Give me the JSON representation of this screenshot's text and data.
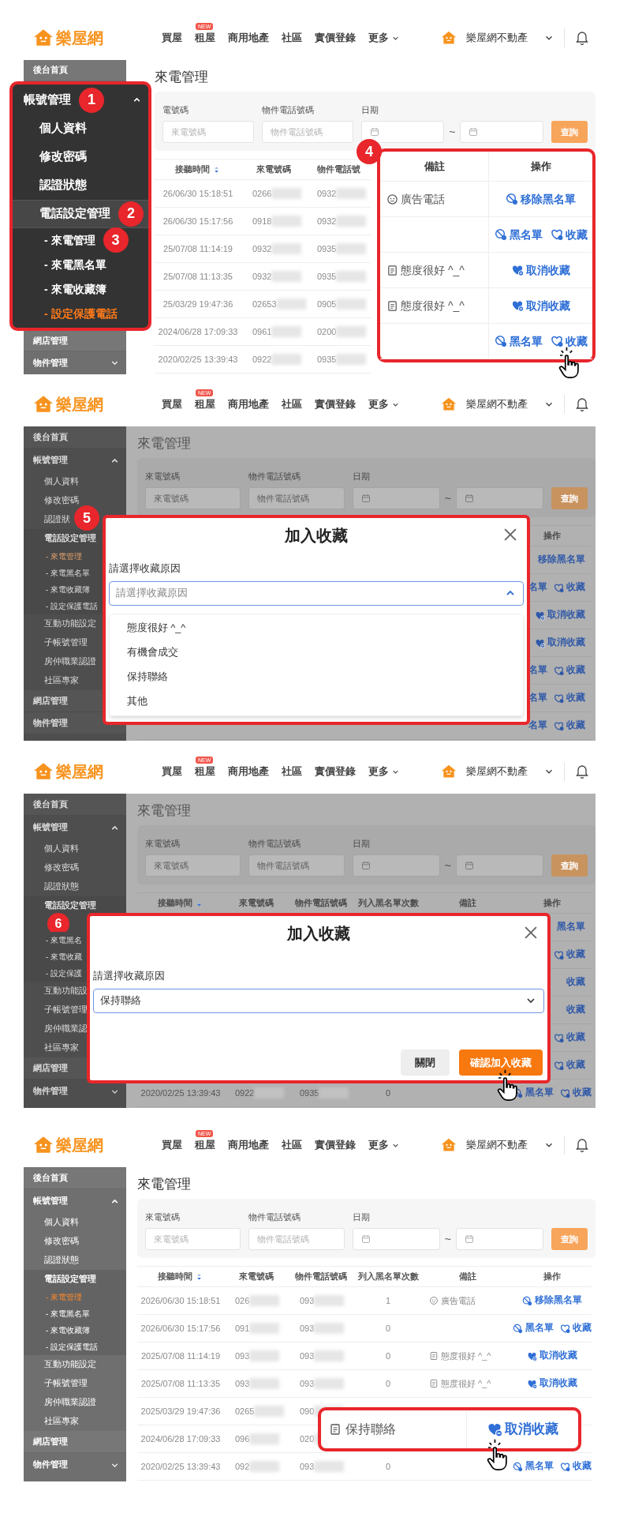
{
  "panels": [
    {
      "dimmed": false,
      "header": {
        "logo": "樂屋網",
        "nav": [
          {
            "label": "買屋",
            "menu": false
          },
          {
            "label": "租屋",
            "badge": "NEW",
            "menu": false
          },
          {
            "label": "商用地產",
            "menu": false
          },
          {
            "label": "社區",
            "menu": false
          },
          {
            "label": "實價登錄",
            "menu": false
          },
          {
            "label": "更多",
            "menu": true
          }
        ],
        "account": "樂屋網不動產"
      },
      "sidebar": [
        {
          "kind": "top",
          "label": "後台首頁"
        },
        {
          "kind": "zoom",
          "items": [
            {
              "kind": "group",
              "label": "帳號管理",
              "expanded": true,
              "step": "1"
            },
            {
              "kind": "item",
              "label": "個人資料"
            },
            {
              "kind": "item",
              "label": "修改密碼"
            },
            {
              "kind": "item",
              "label": "認證狀態"
            },
            {
              "kind": "section",
              "label": "電話設定管理",
              "step": "2"
            },
            {
              "kind": "sub",
              "label": "- 來電管理",
              "selected": false,
              "step": "3"
            },
            {
              "kind": "sub",
              "label": "- 來電黑名單",
              "selected": false
            },
            {
              "kind": "sub",
              "label": "- 來電收藏簿",
              "selected": false
            },
            {
              "kind": "sub",
              "label": "- 設定保護電話",
              "selected": true
            }
          ]
        },
        {
          "kind": "top",
          "label": "網店管理"
        },
        {
          "kind": "group",
          "label": "物件管理",
          "expanded": false
        }
      ],
      "title": "來電管理",
      "filter": {
        "caller_label": "電號碼",
        "caller_placeholder": "來電號碼",
        "property_label": "物件電話號碼",
        "property_placeholder": "物件電話號碼",
        "date_label": "日期",
        "separator": "~",
        "button": "查詢"
      },
      "table": {
        "columns": [
          {
            "kind": "time",
            "label": "接聽時間",
            "sortable": true
          },
          {
            "kind": "caller",
            "label": "來電號碼",
            "sortable": false
          },
          {
            "kind": "property",
            "label": "物件電話號",
            "sortable": false
          }
        ],
        "rows": [
          {
            "time": "26/06/30 15:18:51",
            "caller": "0266",
            "property": "0932"
          },
          {
            "time": "26/06/30 15:17:56",
            "caller": "0918",
            "property": "0932"
          },
          {
            "time": "25/07/08 11:14:19",
            "caller": "0932",
            "property": "0935"
          },
          {
            "time": "25/07/08 11:13:35",
            "caller": "0932",
            "property": "0935"
          },
          {
            "time": "25/03/29 19:47:36",
            "caller": "02653",
            "property": "0905"
          },
          {
            "time": "2024/06/28 17:09:33",
            "caller": "0961",
            "property": "0200"
          },
          {
            "time": "2020/02/25 13:39:43",
            "caller": "0922",
            "property": "0935"
          }
        ],
        "zoom": {
          "step": "4",
          "columns": [
            "備註",
            "操作"
          ],
          "rows": [
            {
              "note": {
                "kind": "face",
                "text": "廣告電話"
              },
              "actions": [
                {
                  "kind": "unblock",
                  "label": "移除黑名單"
                }
              ]
            },
            {
              "actions": [
                {
                  "kind": "block",
                  "label": "黑名單"
                },
                {
                  "kind": "fav",
                  "label": "收藏"
                }
              ]
            },
            {
              "note": {
                "kind": "note",
                "text": "態度很好 ^_^"
              },
              "actions": [
                {
                  "kind": "unfav",
                  "label": "取消收藏"
                }
              ]
            },
            {
              "note": {
                "kind": "note",
                "text": "態度很好 ^_^"
              },
              "actions": [
                {
                  "kind": "unfav",
                  "label": "取消收藏"
                }
              ]
            },
            {
              "actions": [
                {
                  "kind": "block",
                  "label": "黑名單"
                },
                {
                  "kind": "fav",
                  "label": "收藏",
                  "pointer": true
                }
              ]
            }
          ]
        }
      }
    },
    {
      "dimmed": true,
      "header": {
        "logo": "樂屋網",
        "nav": [
          {
            "label": "買屋",
            "menu": false
          },
          {
            "label": "租屋",
            "badge": "NEW",
            "menu": false
          },
          {
            "label": "商用地產",
            "menu": false
          },
          {
            "label": "社區",
            "menu": false
          },
          {
            "label": "實價登錄",
            "menu": false
          },
          {
            "label": "更多",
            "menu": true
          }
        ],
        "account": "樂屋網不動產"
      },
      "sidebar": [
        {
          "kind": "top",
          "label": "後台首頁"
        },
        {
          "kind": "group",
          "label": "帳號管理",
          "expanded": true
        },
        {
          "kind": "item",
          "label": "個人資料"
        },
        {
          "kind": "item",
          "label": "修改密碼"
        },
        {
          "kind": "item",
          "label": "認證狀"
        },
        {
          "kind": "section",
          "label": "電話設定管理"
        },
        {
          "kind": "sub",
          "label": "- 來電管理",
          "selected": true
        },
        {
          "kind": "sub",
          "label": "- 來電黑名單",
          "selected": false
        },
        {
          "kind": "sub",
          "label": "- 來電收藏簿",
          "selected": false
        },
        {
          "kind": "sub",
          "label": "- 設定保護電話",
          "selected": false
        },
        {
          "kind": "item",
          "label": "互動功能設定"
        },
        {
          "kind": "item",
          "label": "子帳號管理"
        },
        {
          "kind": "item",
          "label": "房仲職業認證"
        },
        {
          "kind": "item",
          "label": "社區專家"
        },
        {
          "kind": "top",
          "label": "網店管理"
        },
        {
          "kind": "top",
          "label": "物件管理"
        }
      ],
      "title": "來電管理",
      "filter": {
        "caller_label": "來電號碼",
        "caller_placeholder": "來電號碼",
        "property_label": "物件電話號碼",
        "property_placeholder": "物件電話號碼",
        "date_label": "日期",
        "separator": "~",
        "button": "查詢"
      },
      "table": {
        "columns": [
          {
            "kind": "actions",
            "label": "操作",
            "sortable": false
          }
        ],
        "rows": [
          {
            "clipped": true,
            "actions": [
              {
                "label": "移除黑名單"
              }
            ]
          },
          {
            "clipped": true,
            "actions": [
              {
                "label": "名單"
              },
              {
                "kind": "fav",
                "label": "收藏",
                "icon": true
              }
            ]
          },
          {
            "clipped": true,
            "actions": [
              {
                "kind": "unfav",
                "label": "取消收藏",
                "icon": true
              }
            ]
          },
          {
            "clipped": true,
            "actions": [
              {
                "kind": "unfav",
                "label": "取消收藏",
                "icon": true
              }
            ]
          },
          {
            "clipped": true,
            "actions": [
              {
                "label": "名單"
              },
              {
                "kind": "fav",
                "label": "收藏",
                "icon": true
              }
            ]
          },
          {
            "clipped": true,
            "actions": [
              {
                "label": "名單"
              },
              {
                "kind": "fav",
                "label": "收藏",
                "icon": true
              }
            ]
          },
          {
            "clipped": true,
            "actions": [
              {
                "label": "名單"
              },
              {
                "kind": "fav",
                "label": "收藏",
                "icon": true
              }
            ]
          }
        ]
      },
      "modal": {
        "step": "5",
        "title": "加入收藏",
        "label": "請選擇收藏原因",
        "select": {
          "placeholder": "請選擇收藏原因",
          "expanded": true
        },
        "options": [
          "態度很好 ^_^",
          "有機會成交",
          "保持聯絡",
          "其他"
        ]
      }
    },
    {
      "dimmed": true,
      "header": {
        "logo": "樂屋網",
        "nav": [
          {
            "label": "買屋",
            "menu": false
          },
          {
            "label": "租屋",
            "badge": "NEW",
            "menu": false
          },
          {
            "label": "商用地產",
            "menu": false
          },
          {
            "label": "社區",
            "menu": false
          },
          {
            "label": "實價登錄",
            "menu": false
          },
          {
            "label": "更多",
            "menu": true
          }
        ],
        "account": "樂屋網不動產"
      },
      "sidebar": [
        {
          "kind": "top",
          "label": "後台首頁"
        },
        {
          "kind": "group",
          "label": "帳號管理",
          "expanded": true
        },
        {
          "kind": "item",
          "label": "個人資料"
        },
        {
          "kind": "item",
          "label": "修改密碼"
        },
        {
          "kind": "item",
          "label": "認證狀態"
        },
        {
          "kind": "section",
          "label": "電話設定管理"
        },
        {
          "kind": "covered",
          "step": "6"
        },
        {
          "kind": "sub",
          "label": "- 來電黑名",
          "selected": false
        },
        {
          "kind": "sub",
          "label": "- 來電收藏",
          "selected": false
        },
        {
          "kind": "sub",
          "label": "- 設定保護",
          "selected": false
        },
        {
          "kind": "item",
          "label": "互動功能設"
        },
        {
          "kind": "item",
          "label": "子帳號管理"
        },
        {
          "kind": "item",
          "label": "房仲職業認"
        },
        {
          "kind": "item",
          "label": "社區專家"
        },
        {
          "kind": "top",
          "label": "網店管理"
        },
        {
          "kind": "group",
          "label": "物件管理",
          "expanded": false
        }
      ],
      "title": "來電管理",
      "filter": {
        "caller_label": "來電號碼",
        "caller_placeholder": "來電號碼",
        "property_label": "物件電話號碼",
        "property_placeholder": "物件電話號碼",
        "date_label": "日期",
        "separator": "~",
        "button": "查詢"
      },
      "table": {
        "columns": [
          {
            "kind": "time",
            "label": "接聽時間",
            "sortable": true
          },
          {
            "kind": "caller",
            "label": "來電號碼",
            "sortable": false
          },
          {
            "kind": "property",
            "label": "物件電話號碼",
            "sortable": false
          },
          {
            "kind": "count",
            "label": "列入黑名單次數",
            "sortable": false
          },
          {
            "kind": "note",
            "label": "備註",
            "sortable": false
          },
          {
            "kind": "actions",
            "label": "操作",
            "sortable": false
          }
        ],
        "rows": [
          {
            "clipped": true,
            "actions": [
              {
                "label": "黑名單"
              }
            ]
          },
          {
            "clipped": true,
            "actions": [
              {
                "kind": "fav",
                "label": "收藏",
                "icon": true
              }
            ]
          },
          {
            "clipped": true,
            "actions": [
              {
                "label": "收藏"
              }
            ]
          },
          {
            "clipped": true,
            "actions": [
              {
                "label": "收藏"
              }
            ]
          },
          {
            "clipped": true,
            "actions": [
              {
                "kind": "fav",
                "label": "收藏",
                "icon": true
              }
            ]
          },
          {
            "clipped": true,
            "actions": [
              {
                "kind": "fav",
                "label": "收藏",
                "icon": true
              }
            ]
          },
          {
            "clipped": false,
            "time": "2020/02/25 13:39:43",
            "caller": "0922",
            "property": "0935",
            "count": "0",
            "actions": [
              {
                "kind": "block",
                "label": "黑名單",
                "icon": true
              },
              {
                "kind": "fav",
                "label": "收藏",
                "icon": true
              }
            ]
          }
        ]
      },
      "modal": {
        "title": "加入收藏",
        "label": "請選擇收藏原因",
        "select": {
          "value": "保持聯絡",
          "expanded": false
        },
        "buttons": [
          {
            "kind": "secondary",
            "label": "關閉"
          },
          {
            "kind": "primary",
            "label": "確認加入收藏",
            "pointer": true
          }
        ]
      }
    },
    {
      "dimmed": false,
      "header": {
        "logo": "樂屋網",
        "nav": [
          {
            "label": "買屋",
            "menu": false
          },
          {
            "label": "租屋",
            "badge": "NEW",
            "menu": false
          },
          {
            "label": "商用地產",
            "menu": false
          },
          {
            "label": "社區",
            "menu": false
          },
          {
            "label": "實價登錄",
            "menu": false
          },
          {
            "label": "更多",
            "menu": true
          }
        ],
        "account": "樂屋網不動產"
      },
      "sidebar": [
        {
          "kind": "top",
          "label": "後台首頁"
        },
        {
          "kind": "group",
          "label": "帳號管理",
          "expanded": true
        },
        {
          "kind": "item",
          "label": "個人資料"
        },
        {
          "kind": "item",
          "label": "修改密碼"
        },
        {
          "kind": "item",
          "label": "認證狀態"
        },
        {
          "kind": "section",
          "label": "電話設定管理"
        },
        {
          "kind": "sub",
          "label": "- 來電管理",
          "selected": true
        },
        {
          "kind": "sub",
          "label": "- 來電黑名單",
          "selected": false
        },
        {
          "kind": "sub",
          "label": "- 來電收藏簿",
          "selected": false
        },
        {
          "kind": "sub",
          "label": "- 設定保護電話",
          "selected": false
        },
        {
          "kind": "item",
          "label": "互動功能設定"
        },
        {
          "kind": "item",
          "label": "子帳號管理"
        },
        {
          "kind": "item",
          "label": "房仲職業認證"
        },
        {
          "kind": "item",
          "label": "社區專家"
        },
        {
          "kind": "top",
          "label": "網店管理"
        },
        {
          "kind": "group",
          "label": "物件管理",
          "expanded": false
        }
      ],
      "title": "來電管理",
      "filter": {
        "caller_label": "來電號碼",
        "caller_placeholder": "來電號碼",
        "property_label": "物件電話號碼",
        "property_placeholder": "物件電話號碼",
        "date_label": "日期",
        "separator": "~",
        "button": "查詢"
      },
      "table": {
        "columns": [
          {
            "kind": "time",
            "label": "接聽時間",
            "sortable": true
          },
          {
            "kind": "caller",
            "label": "來電號碼",
            "sortable": false
          },
          {
            "kind": "property",
            "label": "物件電話號碼",
            "sortable": false
          },
          {
            "kind": "count",
            "label": "列入黑名單次數",
            "sortable": false
          },
          {
            "kind": "note",
            "label": "備註",
            "sortable": false
          },
          {
            "kind": "actions",
            "label": "操作",
            "sortable": false
          }
        ],
        "rows": [
          {
            "time": "2026/06/30 15:18:51",
            "caller": "026",
            "property": "093",
            "count": "1",
            "note": {
              "kind": "face",
              "text": "廣告電話"
            },
            "actions": [
              {
                "kind": "unblock",
                "label": "移除黑名單"
              }
            ]
          },
          {
            "time": "2026/06/30 15:17:56",
            "caller": "091",
            "property": "093",
            "count": "0",
            "actions": [
              {
                "kind": "block",
                "label": "黑名單"
              },
              {
                "kind": "fav",
                "label": "收藏"
              }
            ]
          },
          {
            "time": "2025/07/08 11:14:19",
            "caller": "093",
            "property": "093",
            "count": "0",
            "note": {
              "kind": "note",
              "text": "態度很好 ^_^"
            },
            "actions": [
              {
                "kind": "unfav",
                "label": "取消收藏"
              }
            ]
          },
          {
            "time": "2025/07/08 11:13:35",
            "caller": "093",
            "property": "093",
            "count": "0",
            "note": {
              "kind": "note",
              "text": "態度很好 ^_^"
            },
            "actions": [
              {
                "kind": "unfav",
                "label": "取消收藏"
              }
            ]
          },
          {
            "time": "2025/03/29 19:47:36",
            "caller": "0265",
            "property": "090"
          },
          {
            "time": "2024/06/28 17:09:33",
            "caller": "096",
            "property": "020"
          },
          {
            "time": "2020/02/25 13:39:43",
            "caller": "092",
            "property": "093",
            "count": "0",
            "actions": [
              {
                "kind": "block",
                "label": "黑名單"
              },
              {
                "kind": "fav",
                "label": "收藏"
              }
            ]
          }
        ]
      },
      "highlight": {
        "note": {
          "kind": "note",
          "text": "保持聯絡"
        },
        "action": {
          "kind": "unfav",
          "label": "取消收藏",
          "pointer": true
        }
      }
    }
  ]
}
